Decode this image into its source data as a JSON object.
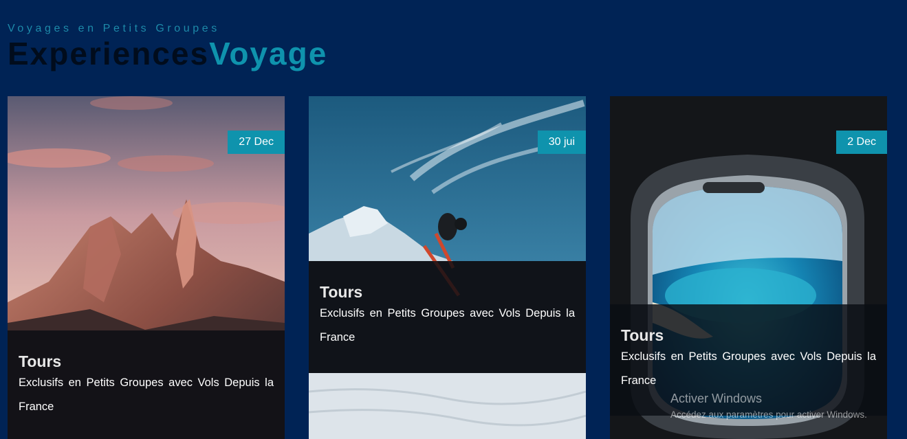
{
  "header": {
    "subtitle": "Voyages en Petits Groupes",
    "brand_part1": "Experiences",
    "brand_part2": "Voyage"
  },
  "cards": [
    {
      "image": "mountain-peaks-sunset",
      "date": "27 Dec",
      "title": "Tours",
      "description": "Exclusifs en Petits Groupes avec Vols Depuis la France"
    },
    {
      "image": "skier-jump-mountain",
      "date": "30 jui",
      "title": "Tours",
      "description": "Exclusifs en Petits Groupes avec Vols Depuis la France"
    },
    {
      "image": "airplane-window-island",
      "date": "2 Dec",
      "title": "Tours",
      "description": "Exclusifs en Petits Groupes avec Vols Depuis la France"
    }
  ],
  "watermark": {
    "line1": "Activer Windows",
    "line2": "Accédez aux paramètres pour activer Windows."
  },
  "colors": {
    "background": "#002355",
    "accent": "#0f93ad",
    "brand_dark": "#010c1c"
  }
}
